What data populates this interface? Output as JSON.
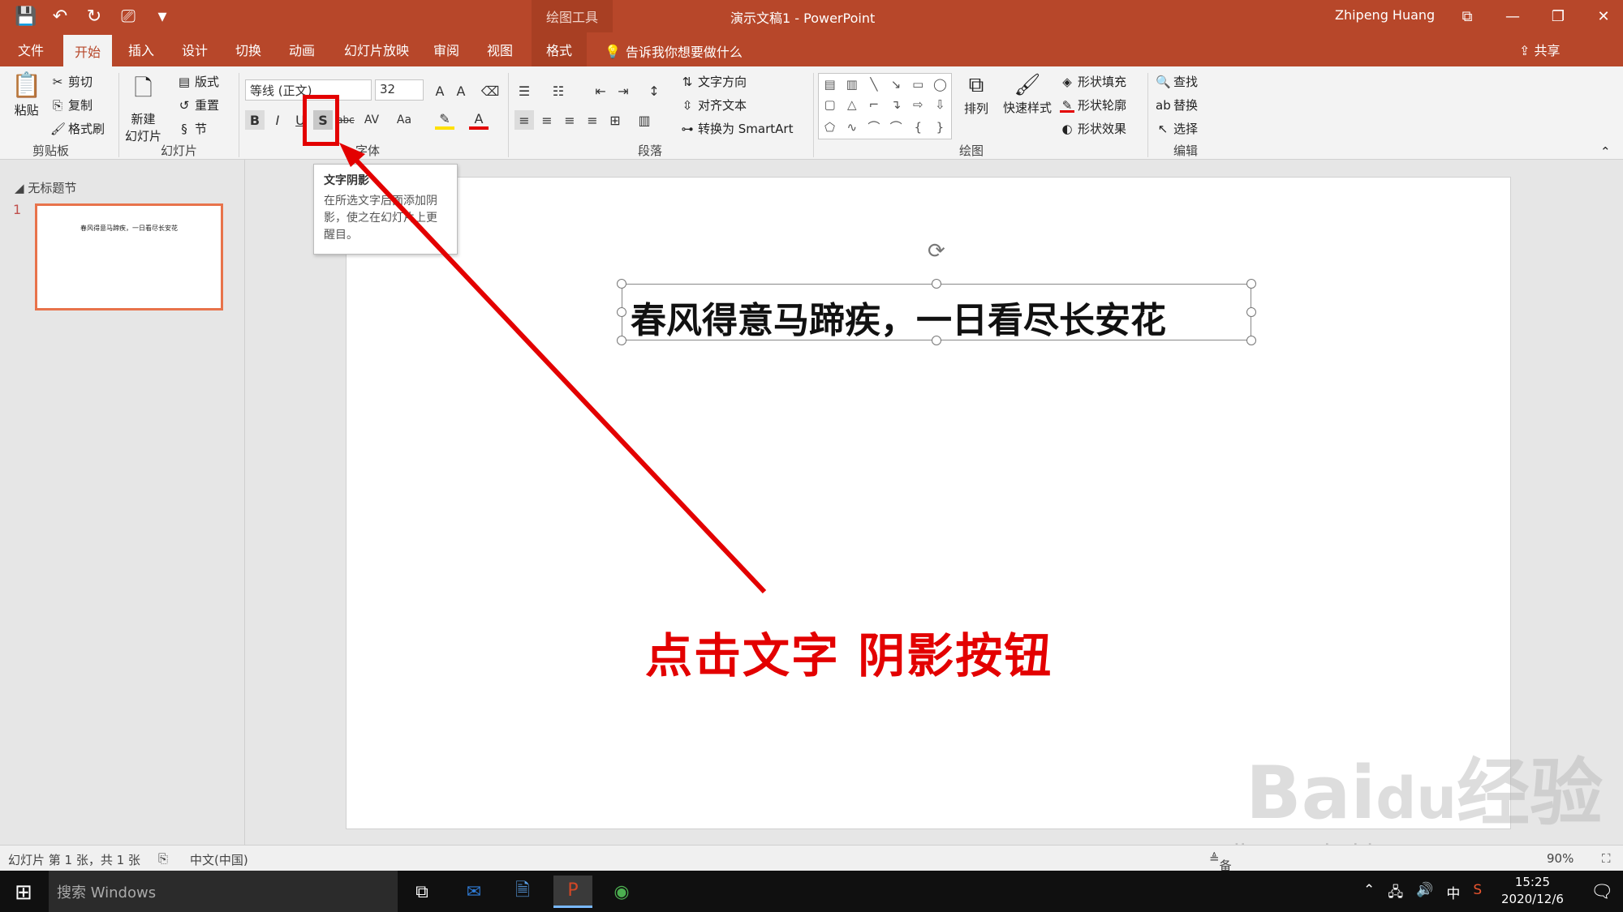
{
  "titlebar": {
    "context_label": "绘图工具",
    "doc_title": "演示文稿1  -  PowerPoint",
    "user": "Zhipeng Huang"
  },
  "tabs": {
    "file": "文件",
    "home": "开始",
    "insert": "插入",
    "design": "设计",
    "transitions": "切换",
    "animations": "动画",
    "slideshow": "幻灯片放映",
    "review": "审阅",
    "view": "视图",
    "format": "格式",
    "tellme": "告诉我你想要做什么",
    "share": "共享"
  },
  "ribbon": {
    "paste": "粘贴",
    "cut": "剪切",
    "copy": "复制",
    "format_painter": "格式刷",
    "clipboard_label": "剪贴板",
    "new_slide": "新建",
    "new_slide2": "幻灯片",
    "layout": "版式",
    "reset": "重置",
    "section": "节",
    "slides_label": "幻灯片",
    "font_name": "等线 (正文)",
    "font_size": "32",
    "font_label": "字体",
    "text_direction": "文字方向",
    "align_text": "对齐文本",
    "smartart": "转换为 SmartArt",
    "paragraph_label": "段落",
    "arrange": "排列",
    "quick_styles": "快速样式",
    "shape_fill": "形状填充",
    "shape_outline": "形状轮廓",
    "shape_effects": "形状效果",
    "drawing_label": "绘图",
    "find": "查找",
    "replace": "替换",
    "select": "选择",
    "editing_label": "编辑"
  },
  "tooltip": {
    "title": "文字阴影",
    "body": "在所选文字后面添加阴影，使之在幻灯片上更醒目。"
  },
  "pane": {
    "section_name": "无标题节",
    "slide_number": "1",
    "thumb_text": "春风得意马蹄疾，一日看尽长安花"
  },
  "slide": {
    "text": "春风得意马蹄疾，一日看尽长安花"
  },
  "annotation": "点击文字 阴影按钮",
  "status": {
    "slide_info": "幻灯片 第 1 张，共 1 张",
    "language": "中文(中国)",
    "notes": "备注",
    "zoom": "90%"
  },
  "taskbar": {
    "search": "搜索 Windows",
    "time": "15:25",
    "date": "2020/12/6",
    "ime": "中"
  },
  "colors": {
    "ppt_accent": "#b7472a",
    "annotation_red": "#e30000"
  }
}
